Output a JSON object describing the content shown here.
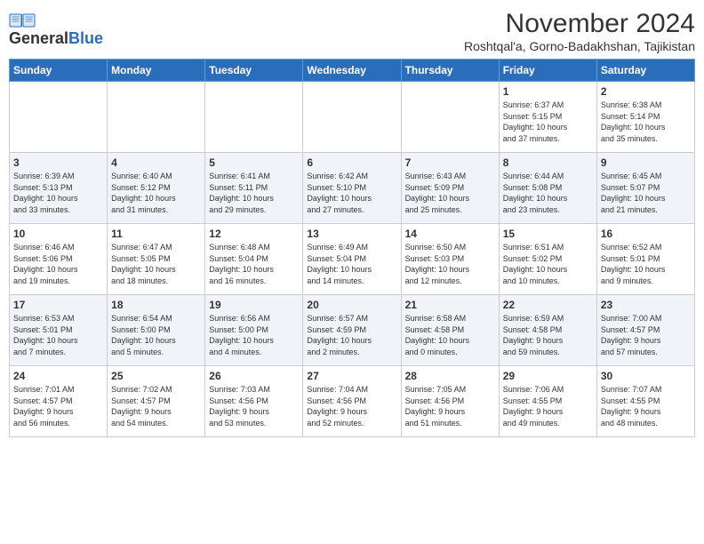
{
  "logo": {
    "general": "General",
    "blue": "Blue"
  },
  "header": {
    "month_title": "November 2024",
    "location": "Roshtqal'a, Gorno-Badakhshan, Tajikistan"
  },
  "weekdays": [
    "Sunday",
    "Monday",
    "Tuesday",
    "Wednesday",
    "Thursday",
    "Friday",
    "Saturday"
  ],
  "weeks": [
    [
      {
        "day": "",
        "info": ""
      },
      {
        "day": "",
        "info": ""
      },
      {
        "day": "",
        "info": ""
      },
      {
        "day": "",
        "info": ""
      },
      {
        "day": "",
        "info": ""
      },
      {
        "day": "1",
        "info": "Sunrise: 6:37 AM\nSunset: 5:15 PM\nDaylight: 10 hours\nand 37 minutes."
      },
      {
        "day": "2",
        "info": "Sunrise: 6:38 AM\nSunset: 5:14 PM\nDaylight: 10 hours\nand 35 minutes."
      }
    ],
    [
      {
        "day": "3",
        "info": "Sunrise: 6:39 AM\nSunset: 5:13 PM\nDaylight: 10 hours\nand 33 minutes."
      },
      {
        "day": "4",
        "info": "Sunrise: 6:40 AM\nSunset: 5:12 PM\nDaylight: 10 hours\nand 31 minutes."
      },
      {
        "day": "5",
        "info": "Sunrise: 6:41 AM\nSunset: 5:11 PM\nDaylight: 10 hours\nand 29 minutes."
      },
      {
        "day": "6",
        "info": "Sunrise: 6:42 AM\nSunset: 5:10 PM\nDaylight: 10 hours\nand 27 minutes."
      },
      {
        "day": "7",
        "info": "Sunrise: 6:43 AM\nSunset: 5:09 PM\nDaylight: 10 hours\nand 25 minutes."
      },
      {
        "day": "8",
        "info": "Sunrise: 6:44 AM\nSunset: 5:08 PM\nDaylight: 10 hours\nand 23 minutes."
      },
      {
        "day": "9",
        "info": "Sunrise: 6:45 AM\nSunset: 5:07 PM\nDaylight: 10 hours\nand 21 minutes."
      }
    ],
    [
      {
        "day": "10",
        "info": "Sunrise: 6:46 AM\nSunset: 5:06 PM\nDaylight: 10 hours\nand 19 minutes."
      },
      {
        "day": "11",
        "info": "Sunrise: 6:47 AM\nSunset: 5:05 PM\nDaylight: 10 hours\nand 18 minutes."
      },
      {
        "day": "12",
        "info": "Sunrise: 6:48 AM\nSunset: 5:04 PM\nDaylight: 10 hours\nand 16 minutes."
      },
      {
        "day": "13",
        "info": "Sunrise: 6:49 AM\nSunset: 5:04 PM\nDaylight: 10 hours\nand 14 minutes."
      },
      {
        "day": "14",
        "info": "Sunrise: 6:50 AM\nSunset: 5:03 PM\nDaylight: 10 hours\nand 12 minutes."
      },
      {
        "day": "15",
        "info": "Sunrise: 6:51 AM\nSunset: 5:02 PM\nDaylight: 10 hours\nand 10 minutes."
      },
      {
        "day": "16",
        "info": "Sunrise: 6:52 AM\nSunset: 5:01 PM\nDaylight: 10 hours\nand 9 minutes."
      }
    ],
    [
      {
        "day": "17",
        "info": "Sunrise: 6:53 AM\nSunset: 5:01 PM\nDaylight: 10 hours\nand 7 minutes."
      },
      {
        "day": "18",
        "info": "Sunrise: 6:54 AM\nSunset: 5:00 PM\nDaylight: 10 hours\nand 5 minutes."
      },
      {
        "day": "19",
        "info": "Sunrise: 6:56 AM\nSunset: 5:00 PM\nDaylight: 10 hours\nand 4 minutes."
      },
      {
        "day": "20",
        "info": "Sunrise: 6:57 AM\nSunset: 4:59 PM\nDaylight: 10 hours\nand 2 minutes."
      },
      {
        "day": "21",
        "info": "Sunrise: 6:58 AM\nSunset: 4:58 PM\nDaylight: 10 hours\nand 0 minutes."
      },
      {
        "day": "22",
        "info": "Sunrise: 6:59 AM\nSunset: 4:58 PM\nDaylight: 9 hours\nand 59 minutes."
      },
      {
        "day": "23",
        "info": "Sunrise: 7:00 AM\nSunset: 4:57 PM\nDaylight: 9 hours\nand 57 minutes."
      }
    ],
    [
      {
        "day": "24",
        "info": "Sunrise: 7:01 AM\nSunset: 4:57 PM\nDaylight: 9 hours\nand 56 minutes."
      },
      {
        "day": "25",
        "info": "Sunrise: 7:02 AM\nSunset: 4:57 PM\nDaylight: 9 hours\nand 54 minutes."
      },
      {
        "day": "26",
        "info": "Sunrise: 7:03 AM\nSunset: 4:56 PM\nDaylight: 9 hours\nand 53 minutes."
      },
      {
        "day": "27",
        "info": "Sunrise: 7:04 AM\nSunset: 4:56 PM\nDaylight: 9 hours\nand 52 minutes."
      },
      {
        "day": "28",
        "info": "Sunrise: 7:05 AM\nSunset: 4:56 PM\nDaylight: 9 hours\nand 51 minutes."
      },
      {
        "day": "29",
        "info": "Sunrise: 7:06 AM\nSunset: 4:55 PM\nDaylight: 9 hours\nand 49 minutes."
      },
      {
        "day": "30",
        "info": "Sunrise: 7:07 AM\nSunset: 4:55 PM\nDaylight: 9 hours\nand 48 minutes."
      }
    ]
  ]
}
